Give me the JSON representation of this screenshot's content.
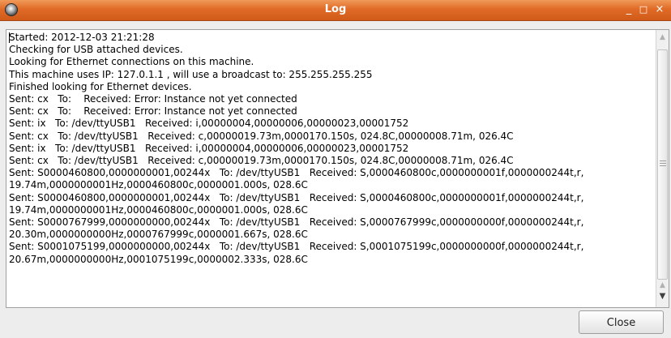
{
  "window": {
    "title": "Log",
    "icon": "app-icon",
    "controls": {
      "minimize": "_",
      "maximize": "□",
      "close": "×"
    }
  },
  "log": {
    "lines": [
      "Started: 2012-12-03 21:21:28",
      "Checking for USB attached devices.",
      "Looking for Ethernet connections on this machine.",
      "This machine uses IP: 127.0.1.1 , will use a broadcast to: 255.255.255.255",
      "Finished looking for Ethernet devices.",
      "Sent: cx   To:    Received: Error: Instance not yet connected",
      "Sent: cx   To:    Received: Error: Instance not yet connected",
      "Sent: ix   To: /dev/ttyUSB1   Received: i,00000004,00000006,00000023,00001752",
      "Sent: cx   To: /dev/ttyUSB1   Received: c,00000019.73m,0000170.150s, 024.8C,00000008.71m, 026.4C",
      "Sent: ix   To: /dev/ttyUSB1   Received: i,00000004,00000006,00000023,00001752",
      "Sent: cx   To: /dev/ttyUSB1   Received: c,00000019.73m,0000170.150s, 024.8C,00000008.71m, 026.4C",
      "Sent: S0000460800,0000000001,00244x   To: /dev/ttyUSB1   Received: S,0000460800c,0000000001f,0000000244t,r,",
      "19.74m,0000000001Hz,0000460800c,0000001.000s, 028.6C",
      "Sent: S0000460800,0000000001,00244x   To: /dev/ttyUSB1   Received: S,0000460800c,0000000001f,0000000244t,r,",
      "19.74m,0000000001Hz,0000460800c,0000001.000s, 028.6C",
      "Sent: S0000767999,0000000000,00244x   To: /dev/ttyUSB1   Received: S,0000767999c,0000000000f,0000000244t,r,",
      "20.30m,0000000000Hz,0000767999c,0000001.667s, 028.6C",
      "Sent: S0001075199,0000000000,00244x   To: /dev/ttyUSB1   Received: S,0001075199c,0000000000f,0000000244t,r,",
      "20.67m,0000000000Hz,0001075199c,0000002.333s, 028.6C"
    ]
  },
  "scrollbar": {
    "up_arrow": "▲",
    "down_arrow": "▼",
    "position": 0.0
  },
  "buttons": {
    "close_label": "Close"
  }
}
